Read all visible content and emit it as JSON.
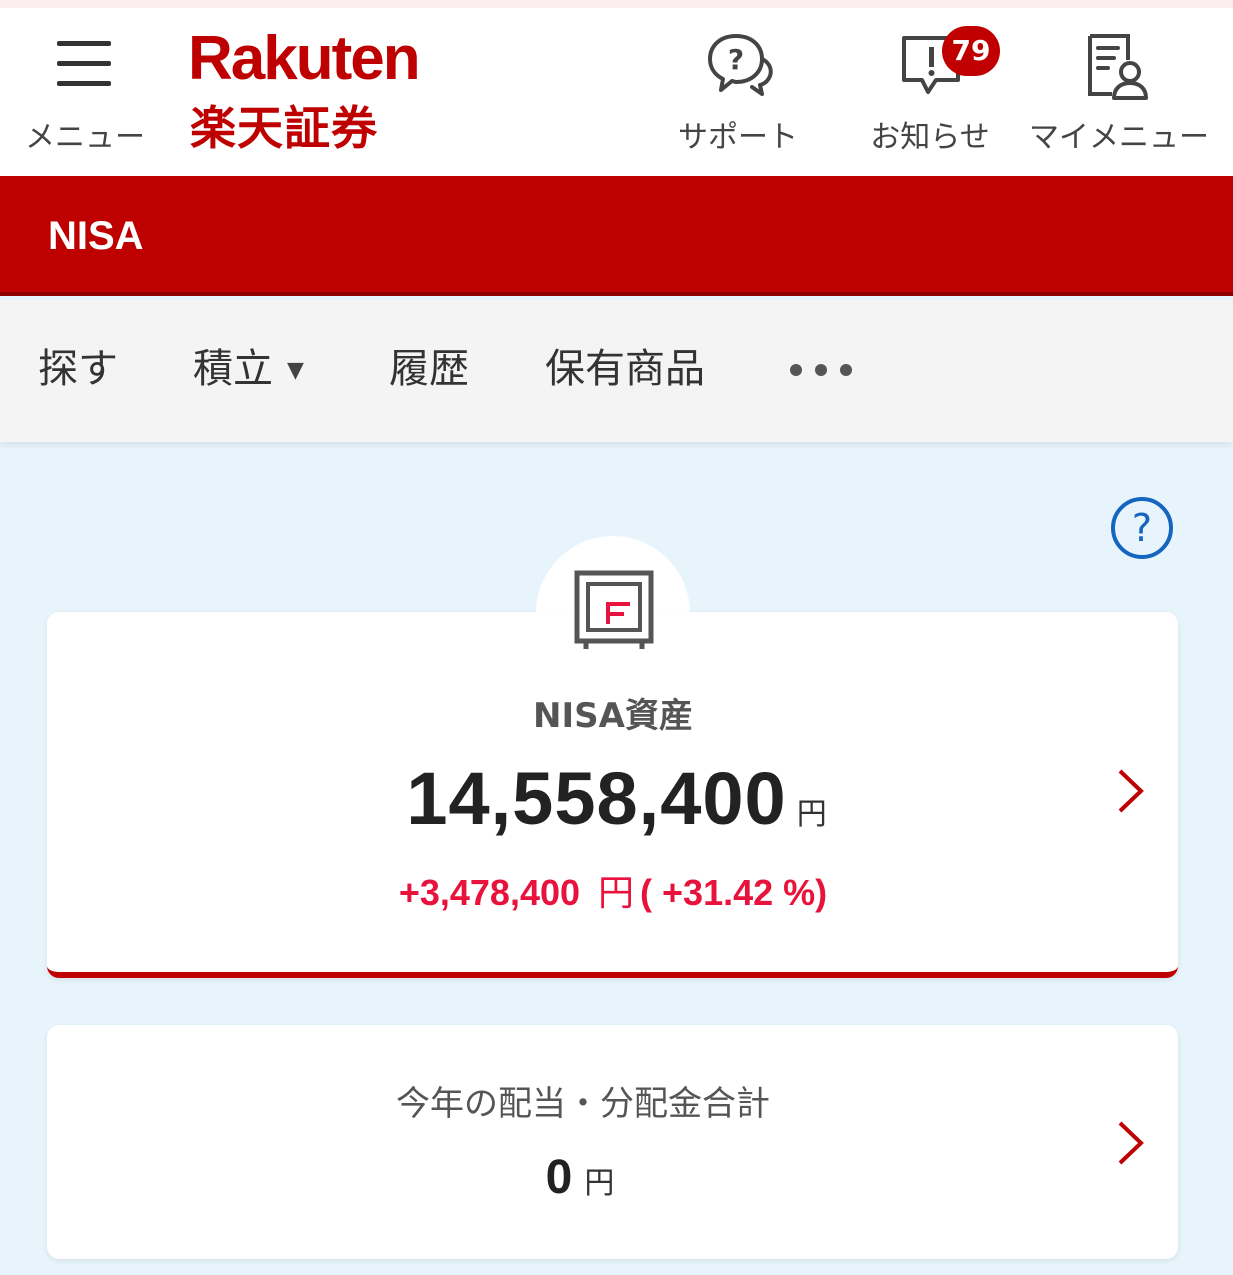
{
  "header": {
    "menu_label": "メニュー",
    "logo_en": "Rakuten",
    "logo_jp": "楽天証券",
    "support_label": "サポート",
    "notice_label": "お知らせ",
    "notice_badge": "79",
    "mymenu_label": "マイメニュー"
  },
  "section_title": "NISA",
  "tabs": [
    {
      "label": "探す"
    },
    {
      "label": "積立"
    },
    {
      "label": "履歴"
    },
    {
      "label": "保有商品"
    }
  ],
  "tab_dropdown_arrow": "▼",
  "asset_card": {
    "title": "NISA資産",
    "value": "14,558,400",
    "unit": "円",
    "gain": "+3,478,400",
    "gain_unit": "円",
    "gain_pct": "( +31.42 %)"
  },
  "dividend_card": {
    "title": "今年の配当・分配金合計",
    "value": "0",
    "unit": "円"
  },
  "colors": {
    "brand_red": "#bf0000",
    "gain_red": "#e8133c",
    "help_blue": "#1565c0",
    "background": "#e8f4fc"
  }
}
